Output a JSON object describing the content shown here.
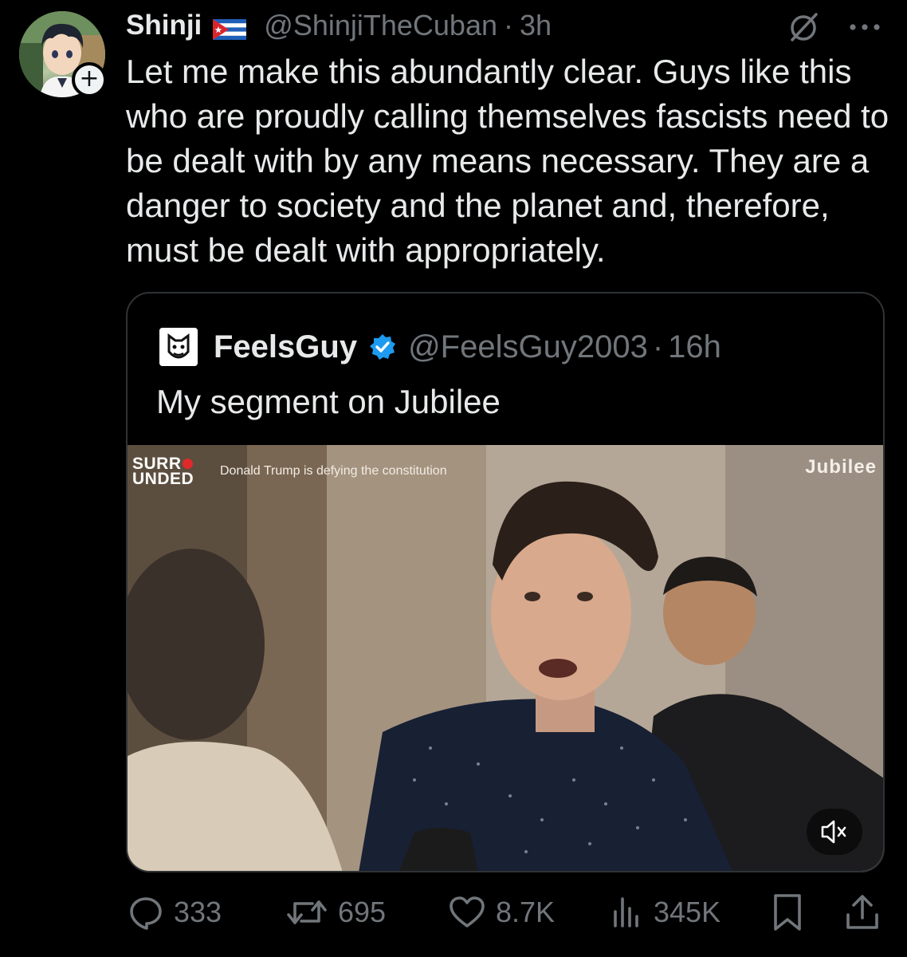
{
  "post": {
    "display_name": "Shinji",
    "handle": "@ShinjiTheCuban",
    "separator": "·",
    "time": "3h",
    "flag_icon": "cuba-flag-icon",
    "follow_symbol": "+",
    "text": "Let me make this abundantly clear. Guys like this who are proudly calling themselves fascists need to be dealt with by any means necessary. They are a danger to society and the planet and, therefore, must be dealt with appropriately."
  },
  "quote": {
    "display_name": "FeelsGuy",
    "handle": "@FeelsGuy2003",
    "separator": "·",
    "time": "16h",
    "verified_color": "#1d9bf0",
    "text": "My segment on Jubilee",
    "video": {
      "brand_line1": "SURR",
      "brand_line2": "UNDED",
      "caption": "Donald Trump is defying the constitution",
      "watermark": "Jubilee",
      "mute_icon": "speaker-muted-icon"
    }
  },
  "actions": {
    "replies": "333",
    "reposts": "695",
    "likes": "8.7K",
    "views": "345K"
  },
  "colors": {
    "background": "#000000",
    "text_primary": "#e7e9ea",
    "text_secondary": "#71767b",
    "border": "#2f3336"
  }
}
